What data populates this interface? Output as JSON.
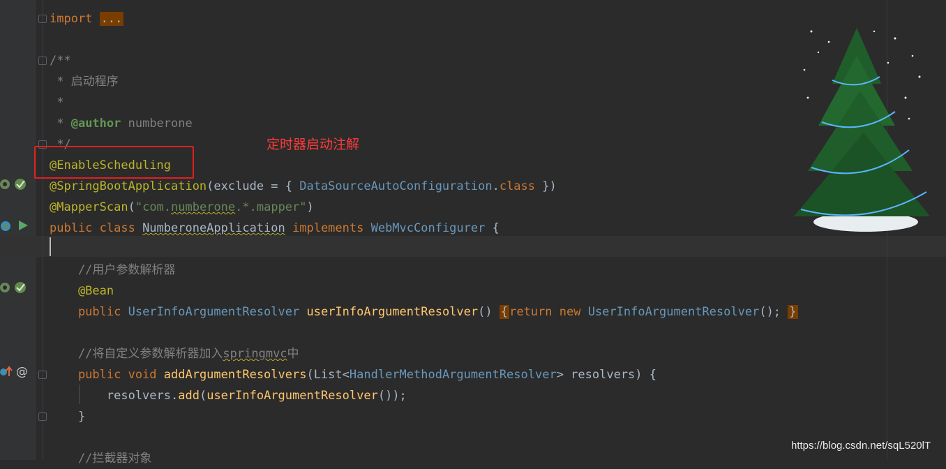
{
  "editor": {
    "lines": [
      {
        "parts": [
          {
            "t": "import ",
            "c": "kw"
          },
          {
            "t": "...",
            "c": "fold-hl"
          }
        ]
      },
      {
        "parts": [
          {
            "t": "/**",
            "c": "cmt"
          }
        ]
      },
      {
        "parts": [
          {
            "t": " * 启动程序",
            "c": "cmt"
          }
        ]
      },
      {
        "parts": [
          {
            "t": " *",
            "c": "cmt"
          }
        ]
      },
      {
        "parts": [
          {
            "t": " * ",
            "c": "cmt"
          },
          {
            "t": "@author",
            "c": "doctag"
          },
          {
            "t": " numberone",
            "c": "cmt"
          }
        ]
      },
      {
        "parts": [
          {
            "t": " */",
            "c": "cmt"
          }
        ]
      },
      {
        "parts": [
          {
            "t": "@EnableScheduling",
            "c": "ann"
          }
        ]
      },
      {
        "parts": [
          {
            "t": "@SpringBootApplication",
            "c": "ann"
          },
          {
            "t": "(exclude = { ",
            "c": ""
          },
          {
            "t": "DataSourceAutoConfiguration",
            "c": "typ"
          },
          {
            "t": ".",
            "c": ""
          },
          {
            "t": "class",
            "c": "kw"
          },
          {
            "t": " })",
            "c": ""
          }
        ]
      },
      {
        "parts": [
          {
            "t": "@MapperScan",
            "c": "ann"
          },
          {
            "t": "(",
            "c": ""
          },
          {
            "t": "\"com.",
            "c": "str"
          },
          {
            "t": "numberone",
            "c": "str squig"
          },
          {
            "t": ".*.mapper\"",
            "c": "str"
          },
          {
            "t": ")",
            "c": ""
          }
        ]
      },
      {
        "parts": [
          {
            "t": "public class ",
            "c": "kw"
          },
          {
            "t": "NumberoneApplication",
            "c": "squig"
          },
          {
            "t": " implements ",
            "c": "kw"
          },
          {
            "t": "WebMvcConfigurer",
            "c": "typ"
          },
          {
            "t": " {",
            "c": ""
          }
        ]
      },
      {
        "parts": []
      },
      {
        "parts": [
          {
            "t": "    //用户参数解析器",
            "c": "cmt"
          }
        ]
      },
      {
        "parts": [
          {
            "t": "    @Bean",
            "c": "ann"
          }
        ]
      },
      {
        "parts": [
          {
            "t": "    public ",
            "c": "kw"
          },
          {
            "t": "UserInfoArgumentResolver",
            "c": "typ"
          },
          {
            "t": " ",
            "c": ""
          },
          {
            "t": "userInfoArgumentResolver",
            "c": "fn"
          },
          {
            "t": "() ",
            "c": ""
          },
          {
            "t": "{",
            "c": "brace-hl"
          },
          {
            "t": "return new ",
            "c": "kw"
          },
          {
            "t": "UserInfoArgumentResolver",
            "c": "typ"
          },
          {
            "t": "(); ",
            "c": ""
          },
          {
            "t": "}",
            "c": "brace-hl"
          }
        ]
      },
      {
        "parts": []
      },
      {
        "parts": [
          {
            "t": "    //将自定义参数解析器加入",
            "c": "cmt"
          },
          {
            "t": "springmvc",
            "c": "cmt squig"
          },
          {
            "t": "中",
            "c": "cmt"
          }
        ]
      },
      {
        "parts": [
          {
            "t": "    public void ",
            "c": "kw"
          },
          {
            "t": "addArgumentResolvers",
            "c": "fn"
          },
          {
            "t": "(List<",
            "c": ""
          },
          {
            "t": "HandlerMethodArgumentResolver",
            "c": "typ"
          },
          {
            "t": "> resolvers) {",
            "c": ""
          }
        ]
      },
      {
        "parts": [
          {
            "t": "        resolvers.",
            "c": ""
          },
          {
            "t": "add",
            "c": "fn"
          },
          {
            "t": "(",
            "c": ""
          },
          {
            "t": "userInfoArgumentResolver",
            "c": "fn"
          },
          {
            "t": "());",
            "c": ""
          }
        ]
      },
      {
        "parts": [
          {
            "t": "    }",
            "c": ""
          }
        ]
      },
      {
        "parts": []
      },
      {
        "parts": [
          {
            "t": "    //拦截器对象",
            "c": "cmt"
          }
        ]
      }
    ]
  },
  "annotation": {
    "label": "定时器启动注解",
    "color": "#ff3a3a"
  },
  "gutter_icons": [
    {
      "name": "bean-icon"
    },
    {
      "name": "spring-check-icon"
    },
    {
      "name": "spring-run-icon"
    },
    {
      "name": "run-arrow-icon"
    },
    {
      "name": "bean-icon-2"
    },
    {
      "name": "spring-check-icon-2"
    },
    {
      "name": "override-up-icon"
    },
    {
      "name": "at-icon"
    }
  ],
  "watermark": "https://blog.csdn.net/sqL520lT",
  "colors": {
    "background": "#2b2b2b",
    "keyword": "#cc7832",
    "annotation": "#bbb529",
    "comment": "#808080",
    "type": "#6897bb",
    "string": "#6a8759",
    "method": "#ffc66d"
  }
}
